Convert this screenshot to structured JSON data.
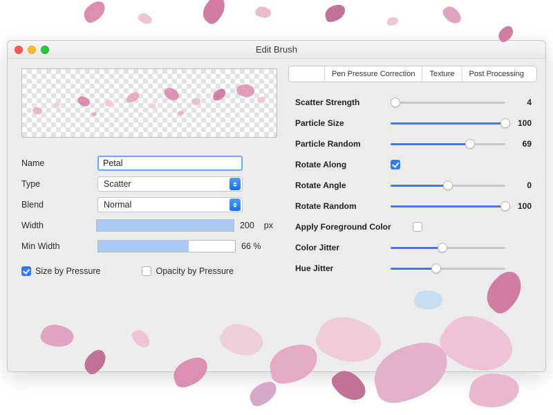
{
  "window": {
    "title": "Edit Brush"
  },
  "left": {
    "name_label": "Name",
    "name_value": "Petal",
    "type_label": "Type",
    "type_value": "Scatter",
    "blend_label": "Blend",
    "blend_value": "Normal",
    "width_label": "Width",
    "width_value": "200",
    "width_unit": "px",
    "width_pct": 100,
    "minwidth_label": "Min Width",
    "minwidth_value": "66 %",
    "minwidth_pct": 66,
    "size_by_pressure_label": "Size by Pressure",
    "size_by_pressure_checked": true,
    "opacity_by_pressure_label": "Opacity by Pressure",
    "opacity_by_pressure_checked": false
  },
  "right": {
    "tabs": [
      {
        "label": ""
      },
      {
        "label": "Pen Pressure Correction"
      },
      {
        "label": "Texture"
      },
      {
        "label": "Post Processing"
      }
    ],
    "sliders": {
      "scatter_strength": {
        "label": "Scatter Strength",
        "value": 4,
        "max": 100
      },
      "particle_size": {
        "label": "Particle Size",
        "value": 100,
        "max": 100
      },
      "particle_random": {
        "label": "Particle Random",
        "value": 69,
        "max": 100
      },
      "rotate_along": {
        "label": "Rotate Along",
        "checked": true
      },
      "rotate_angle": {
        "label": "Rotate Angle",
        "value": 0,
        "display": "0",
        "max": 100,
        "pct": 50
      },
      "rotate_random": {
        "label": "Rotate Random",
        "value": 100,
        "max": 100
      },
      "apply_fg": {
        "label": "Apply Foreground Color",
        "checked": false
      },
      "color_jitter": {
        "label": "Color Jitter",
        "value": 45,
        "max": 100
      },
      "hue_jitter": {
        "label": "Hue Jitter",
        "value": 40,
        "max": 100
      }
    }
  },
  "colors": {
    "accent": "#2f7bff",
    "petal_pinks": [
      "#f4b8cf",
      "#e78fb3",
      "#f2d0dc",
      "#c86f9b",
      "#d9a8c9",
      "#b9d7f0"
    ]
  }
}
